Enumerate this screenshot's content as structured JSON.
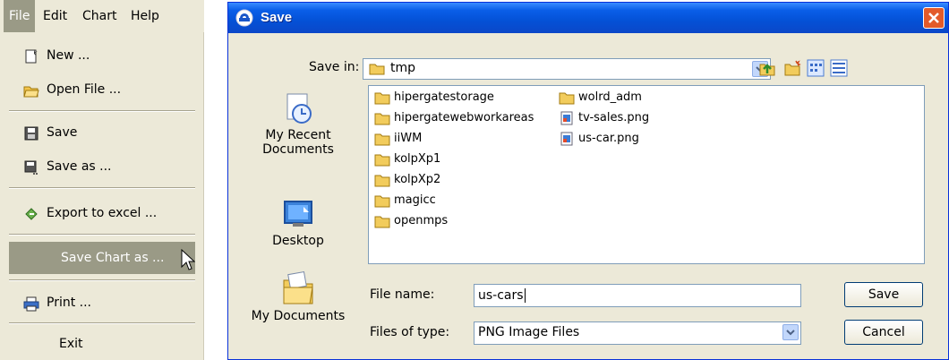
{
  "menu": {
    "bar": {
      "file": "File",
      "edit": "Edit",
      "chart": "Chart",
      "help": "Help"
    },
    "items": {
      "new": "New ...",
      "open_file": "Open File ...",
      "save": "Save",
      "save_as": "Save as ...",
      "export_excel": "Export to excel ...",
      "save_chart_as": "Save Chart as ...",
      "print": "Print ...",
      "exit": "Exit"
    }
  },
  "dialog": {
    "title": "Save",
    "save_in_label": "Save in:",
    "save_in_value": "tmp",
    "places": {
      "recent": "My Recent\nDocuments",
      "desktop": "Desktop",
      "mydocs": "My Documents"
    },
    "files": {
      "col1": [
        "hipergatestorage",
        "hipergatewebworkareas",
        "iiWM",
        "kolpXp1",
        "kolpXp2",
        "magicc",
        "openmps"
      ],
      "col2": [
        "wolrd_adm",
        "tv-sales.png",
        "us-car.png"
      ]
    },
    "file_name_label": "File name:",
    "file_name_value": "us-cars",
    "files_of_type_label": "Files of type:",
    "files_of_type_value": "PNG Image Files",
    "save_button": "Save",
    "cancel_button": "Cancel"
  },
  "colors": {
    "titlebar": "#0451d6",
    "menu_highlight": "#9a9a86",
    "panel": "#ece9d8"
  }
}
